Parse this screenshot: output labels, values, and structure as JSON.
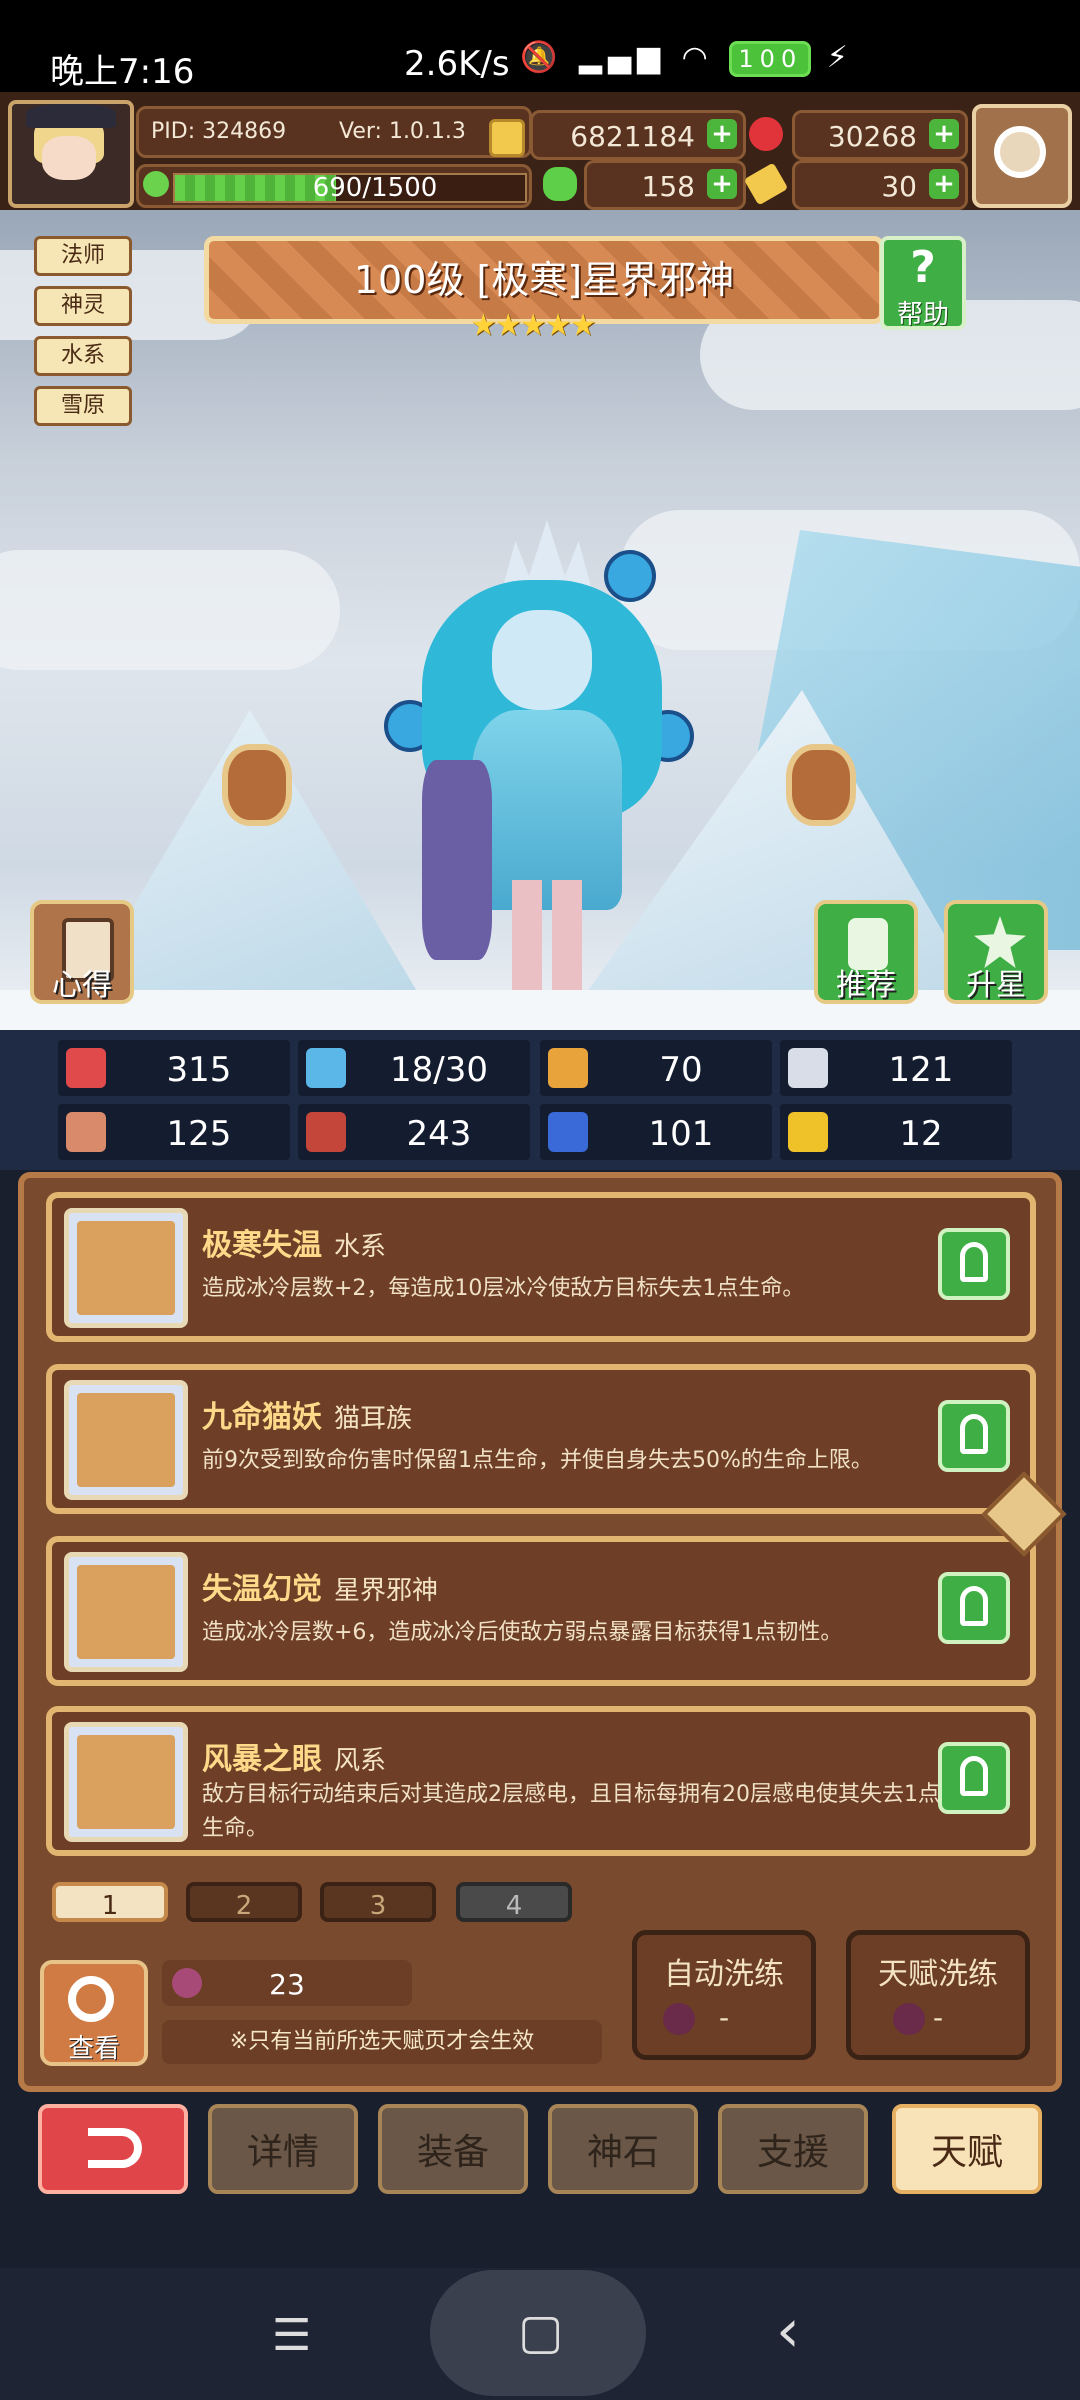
{
  "status_bar": {
    "time": "晚上7:16",
    "speed": "2.6K/s",
    "battery": "100"
  },
  "player": {
    "pid": "PID: 324869",
    "version": "Ver: 1.0.1.3",
    "xp": "690/1500",
    "xp_progress": 0.46
  },
  "resources": {
    "gold": "6821184",
    "gems": "30268",
    "clover": "158",
    "keys": "30"
  },
  "tags": [
    "法师",
    "神灵",
    "水系",
    "雪原"
  ],
  "hero": {
    "title": "100级 [极寒]星界邪神",
    "stars": "★★★★★",
    "star_count": 5
  },
  "scene_buttons": {
    "help": "帮助",
    "notes": "心得",
    "recommend": "推荐",
    "star_up": "升星"
  },
  "stats": [
    {
      "icon": "heart-icon",
      "value": "315",
      "color": "#e04a4a"
    },
    {
      "icon": "water-drop-icon",
      "value": "18/30",
      "color": "#5ab7e8"
    },
    {
      "icon": "shield-icon",
      "value": "70",
      "color": "#e8a33a"
    },
    {
      "icon": "wing-icon",
      "value": "121",
      "color": "#d8dde8"
    },
    {
      "icon": "fist-icon",
      "value": "125",
      "color": "#d88a6a"
    },
    {
      "icon": "book-icon",
      "value": "243",
      "color": "#c4453a"
    },
    {
      "icon": "boot-icon",
      "value": "101",
      "color": "#3a6ad8"
    },
    {
      "icon": "horseshoe-icon",
      "value": "12",
      "color": "#f0c22a"
    }
  ],
  "talents": [
    {
      "name": "极寒失温",
      "tribe": "水系",
      "desc": "造成冰冷层数+2，每造成10层冰冷使敌方目标失去1点生命。"
    },
    {
      "name": "九命猫妖",
      "tribe": "猫耳族",
      "desc": "前9次受到致命伤害时保留1点生命，并使自身失去50%的生命上限。"
    },
    {
      "name": "失温幻觉",
      "tribe": "星界邪神",
      "desc": "造成冰冷层数+6，造成冰冷后使敌方弱点暴露目标获得1点韧性。"
    },
    {
      "name": "风暴之眼",
      "tribe": "风系",
      "desc": "敌方目标行动结束后对其造成2层感电，且目标每拥有20层感电使其失去1点生命。"
    }
  ],
  "pages": [
    "1",
    "2",
    "3",
    "4"
  ],
  "active_page": "1",
  "orb_count": "23",
  "note": "※只有当前所选天赋页才会生效",
  "view_label": "查看",
  "auto_wash": {
    "label": "自动洗练",
    "cost": "-"
  },
  "talent_wash": {
    "label": "天赋洗练",
    "cost": "-"
  },
  "nav": [
    "详情",
    "装备",
    "神石",
    "支援",
    "天赋"
  ],
  "active_nav": "天赋",
  "android_nav": {
    "menu": "☰",
    "home": "▢",
    "back": "‹"
  }
}
